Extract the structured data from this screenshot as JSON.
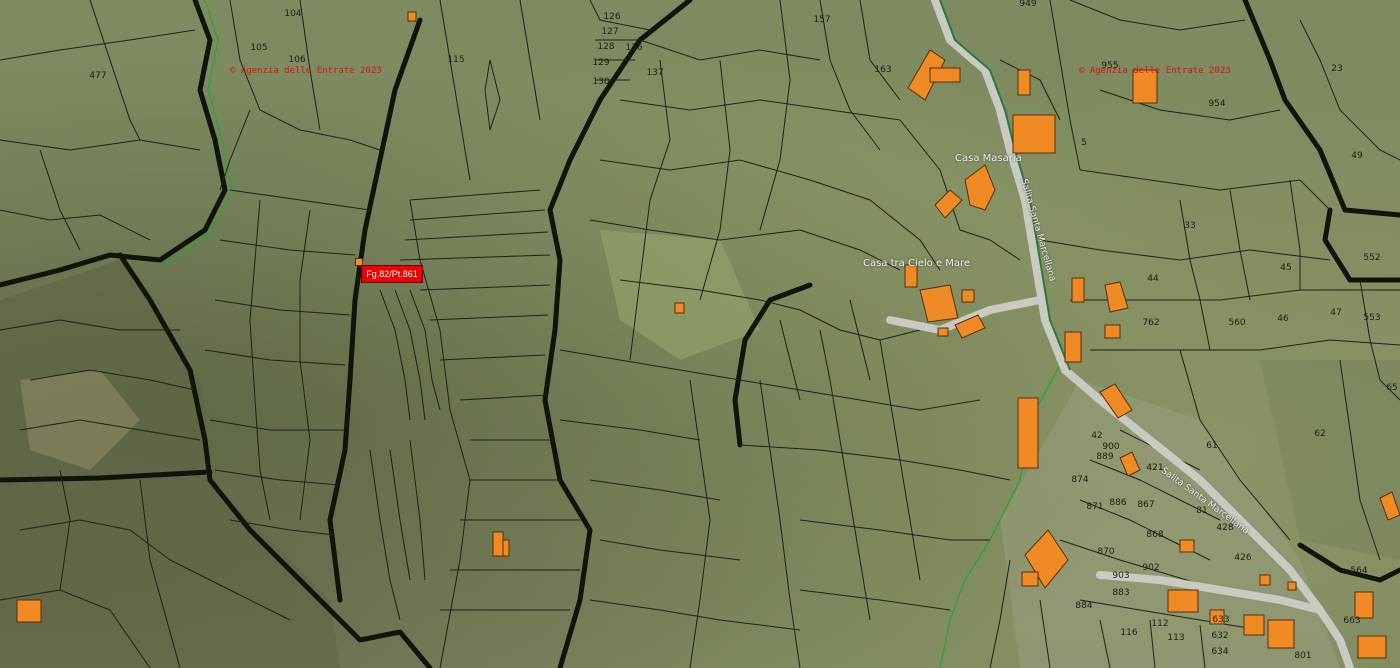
{
  "map": {
    "copyright_text": "© Agenzia delle Entrate 2023",
    "copyright_color": "#e01010",
    "marker": {
      "label": "Fg.82/Pt.861",
      "color": "#ee0000"
    },
    "building_color": "#f08a24",
    "place_names": {
      "casa_masaria": "Casa Masaria",
      "casa_cielo_mare": "Casa tra Cielo e Mare"
    },
    "street_names": {
      "upper": "Salita Santa Marcellana",
      "lower": "Salita Santa Marcellana"
    },
    "parcel_numbers": {
      "p104": "104",
      "p105": "105",
      "p106": "106",
      "p477": "477",
      "p115": "115",
      "p126": "126",
      "p127": "127",
      "p128": "128",
      "p129": "129",
      "p130": "130",
      "p136": "136",
      "p137": "137",
      "p157": "157",
      "p163": "163",
      "p949": "949",
      "p23": "23",
      "p954": "954",
      "p955": "955",
      "p49": "49",
      "p5": "5",
      "p33": "33",
      "p552": "552",
      "p44": "44",
      "p45": "45",
      "p762": "762",
      "p560": "560",
      "p46": "46",
      "p47": "47",
      "p553": "553",
      "p65": "65",
      "p61": "61",
      "p62": "62",
      "p900": "900",
      "p889": "889",
      "p874": "874",
      "p871": "871",
      "p886": "886",
      "p867": "867",
      "p81": "81",
      "p426": "426",
      "p428": "428",
      "p870": "870",
      "p902": "902",
      "p903": "903",
      "p884": "884",
      "p883": "883",
      "p112": "112",
      "p113": "113",
      "p116": "116",
      "p633": "633",
      "p632": "632",
      "p634": "634",
      "p564": "564",
      "p663": "663",
      "p801": "801",
      "p42": "42",
      "p421": "421",
      "p868": "868"
    }
  }
}
